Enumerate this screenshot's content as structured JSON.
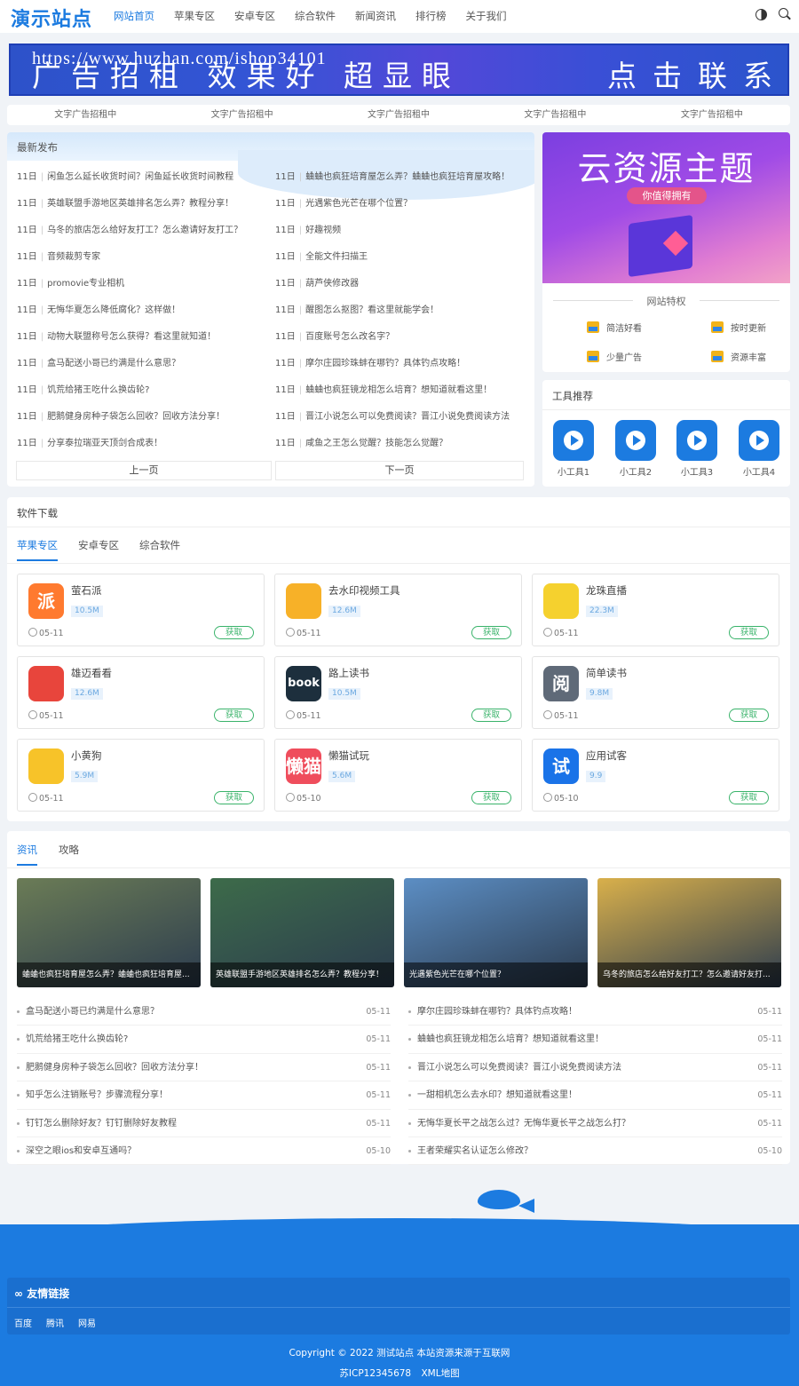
{
  "header": {
    "logo": "演示站点",
    "nav": [
      "网站首页",
      "苹果专区",
      "安卓专区",
      "综合软件",
      "新闻资讯",
      "排行榜",
      "关于我们"
    ]
  },
  "banner": {
    "watermark": "https://www.huzhan.com/ishop34101",
    "text": "广告招租  效果好 超显眼",
    "cta": "点击联系"
  },
  "text_ads": [
    "文字广告招租中",
    "文字广告招租中",
    "文字广告招租中",
    "文字广告招租中",
    "文字广告招租中"
  ],
  "latest": {
    "title": "最新发布",
    "left": [
      {
        "day": "11日",
        "title": "闲鱼怎么延长收货时间？闲鱼延长收货时间教程"
      },
      {
        "day": "11日",
        "title": "英雄联盟手游地区英雄排名怎么弄？教程分享！"
      },
      {
        "day": "11日",
        "title": "乌冬的旅店怎么给好友打工？怎么邀请好友打工？"
      },
      {
        "day": "11日",
        "title": "音频裁剪专家"
      },
      {
        "day": "11日",
        "title": "promovie专业相机"
      },
      {
        "day": "11日",
        "title": "无悔华夏怎么降低腐化？这样做！"
      },
      {
        "day": "11日",
        "title": "动物大联盟称号怎么获得？看这里就知道！"
      },
      {
        "day": "11日",
        "title": "盒马配送小哥已约满是什么意思？"
      },
      {
        "day": "11日",
        "title": "饥荒给猪王吃什么换齿轮?"
      },
      {
        "day": "11日",
        "title": "肥鹅健身房种子袋怎么回收？回收方法分享！"
      },
      {
        "day": "11日",
        "title": "分享泰拉瑞亚天顶剑合成表！"
      }
    ],
    "right": [
      {
        "day": "11日",
        "title": "蛐蛐也疯狂培育屋怎么弄？蛐蛐也疯狂培育屋攻略！"
      },
      {
        "day": "11日",
        "title": "光遇紫色光芒在哪个位置？"
      },
      {
        "day": "11日",
        "title": "好趣视频"
      },
      {
        "day": "11日",
        "title": "全能文件扫描王"
      },
      {
        "day": "11日",
        "title": "葫芦侠修改器"
      },
      {
        "day": "11日",
        "title": "醒图怎么抠图？看这里就能学会！"
      },
      {
        "day": "11日",
        "title": "百度账号怎么改名字？"
      },
      {
        "day": "11日",
        "title": "摩尔庄园珍珠蚌在哪钓？具体钓点攻略！"
      },
      {
        "day": "11日",
        "title": "蛐蛐也疯狂镜龙相怎么培育？想知道就看这里！"
      },
      {
        "day": "11日",
        "title": "晋江小说怎么可以免费阅读？晋江小说免费阅读方法"
      },
      {
        "day": "11日",
        "title": "咸鱼之王怎么觉醒？技能怎么觉醒？"
      }
    ],
    "prev": "上一页",
    "next": "下一页"
  },
  "promo": {
    "title": "云资源主题",
    "subtitle": "你值得拥有"
  },
  "features": {
    "title": "网站特权",
    "items": [
      "简洁好看",
      "按时更新",
      "少量广告",
      "资源丰富"
    ]
  },
  "tools": {
    "title": "工具推荐",
    "items": [
      "小工具1",
      "小工具2",
      "小工具3",
      "小工具4"
    ]
  },
  "software": {
    "title": "软件下载",
    "tabs": [
      "苹果专区",
      "安卓专区",
      "综合软件"
    ],
    "button_label": "获取",
    "apps": [
      {
        "name": "萤石派",
        "size": "10.5M",
        "date": "05-11",
        "icon": "派",
        "color": "#ff7a2f"
      },
      {
        "name": "去水印视频工具",
        "size": "12.6M",
        "date": "05-11",
        "icon": "",
        "color": "#f7b128"
      },
      {
        "name": "龙珠直播",
        "size": "22.3M",
        "date": "05-11",
        "icon": "",
        "color": "#f5d12e"
      },
      {
        "name": "雄迈看看",
        "size": "12.6M",
        "date": "05-11",
        "icon": "",
        "color": "#e8453c"
      },
      {
        "name": "路上读书",
        "size": "10.5M",
        "date": "05-11",
        "icon": "book",
        "color": "#1d2f3d"
      },
      {
        "name": "简单读书",
        "size": "9.8M",
        "date": "05-11",
        "icon": "阅",
        "color": "#5f6a78"
      },
      {
        "name": "小黄狗",
        "size": "5.9M",
        "date": "05-11",
        "icon": "",
        "color": "#f7c329"
      },
      {
        "name": "懒猫试玩",
        "size": "5.6M",
        "date": "05-10",
        "icon": "懒猫",
        "color": "#ef4d5c"
      },
      {
        "name": "应用试客",
        "size": "9.9",
        "date": "05-10",
        "icon": "试",
        "color": "#1a73e8"
      }
    ]
  },
  "news": {
    "tabs": [
      "资讯",
      "攻略"
    ],
    "thumbs": [
      {
        "caption": "蛐蛐也疯狂培育屋怎么弄？蛐蛐也疯狂培育屋...",
        "color": "#6b7c56"
      },
      {
        "caption": "英雄联盟手游地区英雄排名怎么弄？教程分享！",
        "color": "#3d6b4a"
      },
      {
        "caption": "光遇紫色光芒在哪个位置？",
        "color": "#5c8ec4"
      },
      {
        "caption": "乌冬的旅店怎么给好友打工？怎么邀请好友打...",
        "color": "#d9b04b"
      }
    ],
    "left": [
      {
        "title": "盒马配送小哥已约满是什么意思？",
        "date": "05-11"
      },
      {
        "title": "饥荒给猪王吃什么换齿轮?",
        "date": "05-11"
      },
      {
        "title": "肥鹅健身房种子袋怎么回收？回收方法分享！",
        "date": "05-11"
      },
      {
        "title": "知乎怎么注销账号？步骤流程分享！",
        "date": "05-11"
      },
      {
        "title": "钉钉怎么删除好友？钉钉删除好友教程",
        "date": "05-11"
      },
      {
        "title": "深空之眼ios和安卓互通吗？",
        "date": "05-10"
      }
    ],
    "right": [
      {
        "title": "摩尔庄园珍珠蚌在哪钓？具体钓点攻略！",
        "date": "05-11"
      },
      {
        "title": "蛐蛐也疯狂镜龙相怎么培育？想知道就看这里！",
        "date": "05-11"
      },
      {
        "title": "晋江小说怎么可以免费阅读？晋江小说免费阅读方法",
        "date": "05-11"
      },
      {
        "title": "一甜相机怎么去水印？想知道就看这里！",
        "date": "05-11"
      },
      {
        "title": "无悔华夏长平之战怎么过？无悔华夏长平之战怎么打？",
        "date": "05-11"
      },
      {
        "title": "王者荣耀实名认证怎么修改？",
        "date": "05-10"
      }
    ]
  },
  "footer": {
    "links_title": "友情链接",
    "links": [
      "百度",
      "腾讯",
      "网易"
    ],
    "copyright": "Copyright © 2022 测试站点 本站资源来源于互联网",
    "icp": "苏ICP12345678",
    "sitemap": "XML地图"
  }
}
